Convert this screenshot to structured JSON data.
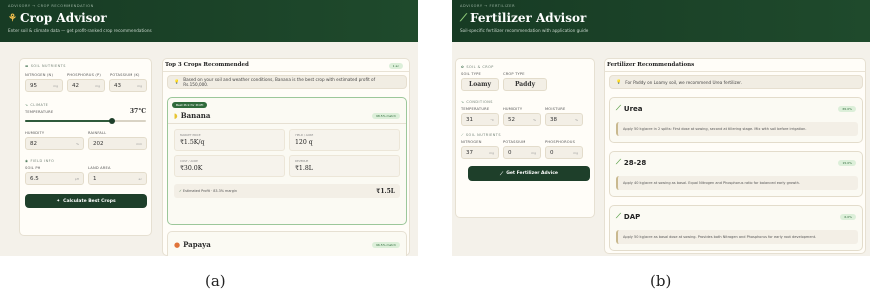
{
  "crop": {
    "header": {
      "crumb": "ADVISORY → CROP RECOMMENDATION",
      "title": "Crop Advisor",
      "subtitle": "Enter soil & climate data — get profit-ranked crop recommendations"
    },
    "soil": {
      "section": "SOIL NUTRIENTS",
      "n_label": "NITROGEN (N)",
      "n_value": "95",
      "n_unit": "mg",
      "p_label": "PHOSPHORUS (P)",
      "p_value": "42",
      "p_unit": "mg",
      "k_label": "POTASSIUM (K)",
      "k_value": "43",
      "k_unit": "mg"
    },
    "climate": {
      "section": "CLIMATE",
      "temp_label": "TEMPERATURE",
      "temp_value": "37°C",
      "temp_fraction": 0.72,
      "humidity_label": "HUMIDITY",
      "humidity_value": "82",
      "humidity_unit": "%",
      "rainfall_label": "RAINFALL",
      "rainfall_value": "202",
      "rainfall_unit": "mm"
    },
    "field": {
      "section": "FIELD INFO",
      "ph_label": "SOIL PH",
      "ph_value": "6.5",
      "ph_unit": "pH",
      "area_label": "LAND AREA",
      "area_value": "1",
      "area_unit": "ac"
    },
    "button": "Calculate Best Crops",
    "results": {
      "title": "Top 3 Crops Recommended",
      "badge": "1 ac",
      "note": "Based on your soil and weather conditions, Banana is the best crop with estimated profit of Rs.150,000.",
      "top": {
        "tag": "Best Pick for Profit",
        "name": "Banana",
        "match": "98.5% match",
        "price_label": "MARKET PRICE",
        "price_value": "₹1.5K/q",
        "yield_label": "YIELD / ACRE",
        "yield_value": "120 q",
        "cost_label": "COST / ACRE",
        "cost_value": "₹30.0K",
        "revenue_label": "REVENUE",
        "revenue_value": "₹1.8L",
        "profit_label": "Estimated Profit · 83.3% margin",
        "profit_value": "₹1.5L"
      },
      "second": {
        "name": "Papaya",
        "match": "96.5% match"
      }
    }
  },
  "fert": {
    "header": {
      "crumb": "ADVISORY → FERTILIZER",
      "title": "Fertilizer Advisor",
      "subtitle": "Soil-specific fertilizer recommendation with application guide"
    },
    "soilcrop": {
      "section": "SOIL & CROP",
      "soil_label": "SOIL TYPE",
      "soil_value": "Loamy",
      "crop_label": "CROP TYPE",
      "crop_value": "Paddy"
    },
    "conditions": {
      "section": "CONDITIONS",
      "temp_label": "TEMPERATURE",
      "temp_value": "31",
      "temp_unit": "°C",
      "hum_label": "HUMIDITY",
      "hum_value": "52",
      "hum_unit": "%",
      "moist_label": "MOISTURE",
      "moist_value": "38",
      "moist_unit": "%"
    },
    "nutrients": {
      "section": "SOIL NUTRIENTS",
      "n_label": "NITROGEN",
      "n_value": "37",
      "n_unit": "mg",
      "k_label": "POTASSIUM",
      "k_value": "0",
      "k_unit": "mg",
      "p_label": "PHOSPHOROUS",
      "p_value": "0",
      "p_unit": "mg"
    },
    "button": "Get Fertilizer Advice",
    "results": {
      "title": "Fertilizer Recommendations",
      "note": "For Paddy on Loamy soil, we recommend Urea fertilizer.",
      "items": [
        {
          "name": "Urea",
          "pct": "65.0%",
          "desc": "Apply 50 kg/acre in 2 splits: First dose at sowing, second at tillering stage. Mix with soil before irrigation."
        },
        {
          "name": "28-28",
          "pct": "15.0%",
          "desc": "Apply 40 kg/acre at sowing as basal. Equal Nitrogen and Phosphorus ratio for balanced early growth."
        },
        {
          "name": "DAP",
          "pct": "6.0%",
          "desc": "Apply 50 kg/acre as basal dose at sowing. Provides both Nitrogen and Phosphorus for early root development."
        }
      ]
    }
  },
  "captions": {
    "a": "(a)",
    "b": "(b)"
  }
}
